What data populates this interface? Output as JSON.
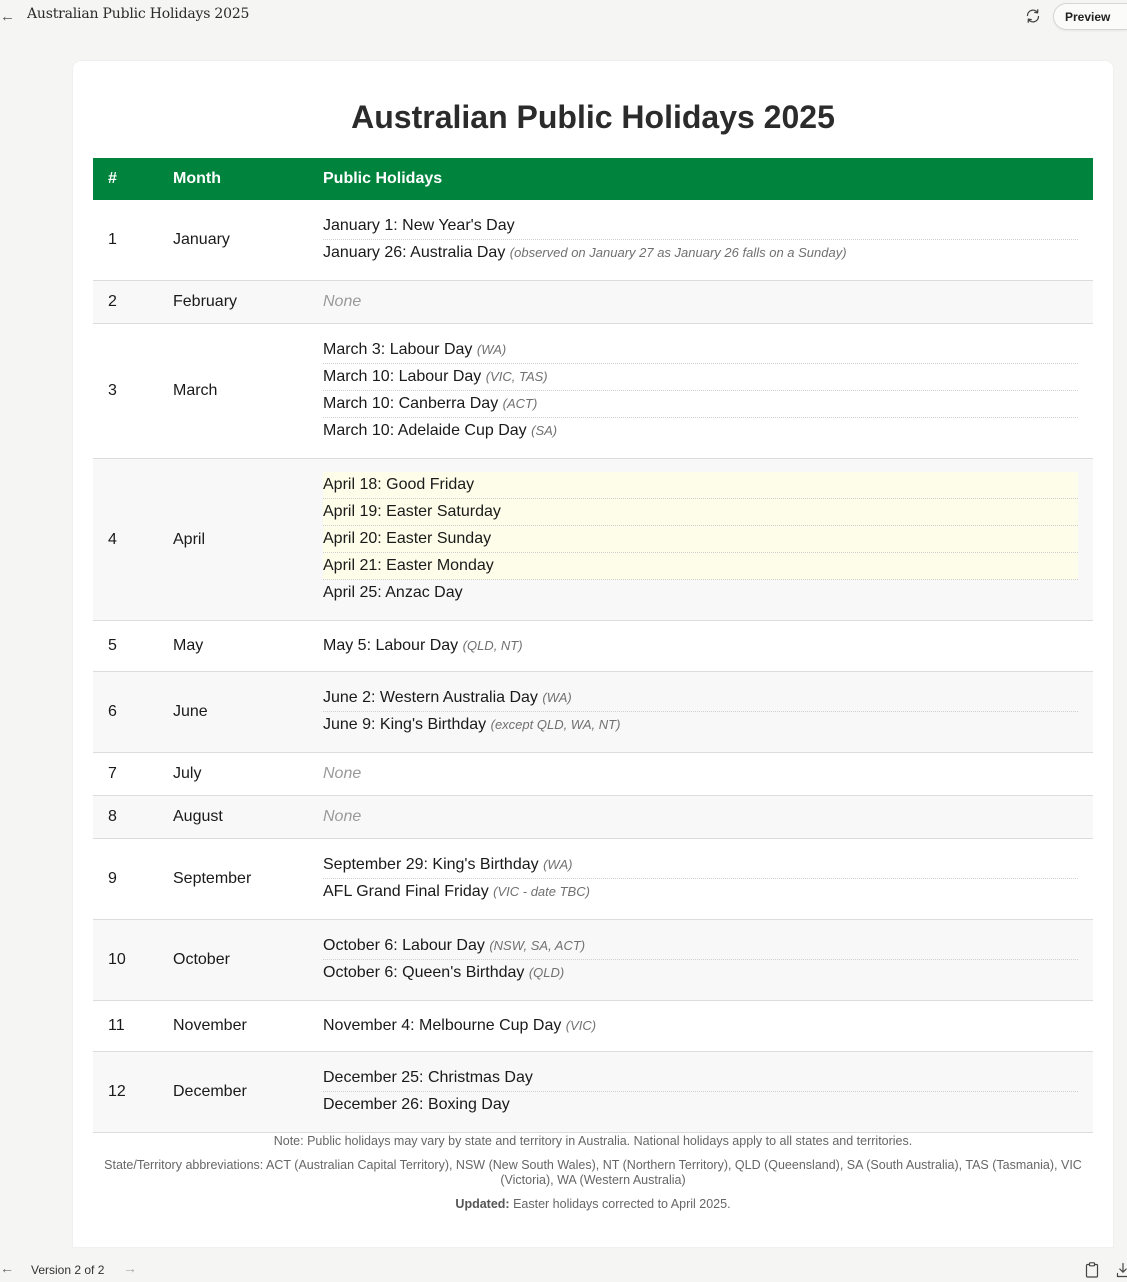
{
  "topbar": {
    "title": "Australian Public Holidays 2025",
    "preview_label": "Preview"
  },
  "page": {
    "title": "Australian Public Holidays 2025"
  },
  "table": {
    "headers": [
      "#",
      "Month",
      "Public Holidays"
    ],
    "rows": [
      {
        "num": "1",
        "month": "January",
        "holidays": [
          {
            "text": "January 1: New Year's Day",
            "note": "",
            "highlight": false
          },
          {
            "text": "January 26: Australia Day",
            "note": "(observed on January 27 as January 26 falls on a Sunday)",
            "highlight": false
          }
        ]
      },
      {
        "num": "2",
        "month": "February",
        "none": "None",
        "holidays": []
      },
      {
        "num": "3",
        "month": "March",
        "holidays": [
          {
            "text": "March 3: Labour Day",
            "note": "(WA)",
            "highlight": false
          },
          {
            "text": "March 10: Labour Day",
            "note": "(VIC, TAS)",
            "highlight": false
          },
          {
            "text": "March 10: Canberra Day",
            "note": "(ACT)",
            "highlight": false
          },
          {
            "text": "March 10: Adelaide Cup Day",
            "note": "(SA)",
            "highlight": false
          }
        ]
      },
      {
        "num": "4",
        "month": "April",
        "holidays": [
          {
            "text": "April 18: Good Friday",
            "note": "",
            "highlight": true
          },
          {
            "text": "April 19: Easter Saturday",
            "note": "",
            "highlight": true
          },
          {
            "text": "April 20: Easter Sunday",
            "note": "",
            "highlight": true
          },
          {
            "text": "April 21: Easter Monday",
            "note": "",
            "highlight": true
          },
          {
            "text": "April 25: Anzac Day",
            "note": "",
            "highlight": false
          }
        ]
      },
      {
        "num": "5",
        "month": "May",
        "holidays": [
          {
            "text": "May 5: Labour Day",
            "note": "(QLD, NT)",
            "highlight": false
          }
        ]
      },
      {
        "num": "6",
        "month": "June",
        "holidays": [
          {
            "text": "June 2: Western Australia Day",
            "note": "(WA)",
            "highlight": false
          },
          {
            "text": "June 9: King's Birthday",
            "note": "(except QLD, WA, NT)",
            "highlight": false
          }
        ]
      },
      {
        "num": "7",
        "month": "July",
        "none": "None",
        "holidays": []
      },
      {
        "num": "8",
        "month": "August",
        "none": "None",
        "holidays": []
      },
      {
        "num": "9",
        "month": "September",
        "holidays": [
          {
            "text": "September 29: King's Birthday",
            "note": "(WA)",
            "highlight": false
          },
          {
            "text": "AFL Grand Final Friday",
            "note": "(VIC - date TBC)",
            "highlight": false
          }
        ]
      },
      {
        "num": "10",
        "month": "October",
        "holidays": [
          {
            "text": "October 6: Labour Day",
            "note": "(NSW, SA, ACT)",
            "highlight": false
          },
          {
            "text": "October 6: Queen's Birthday",
            "note": "(QLD)",
            "highlight": false
          }
        ]
      },
      {
        "num": "11",
        "month": "November",
        "holidays": [
          {
            "text": "November 4: Melbourne Cup Day",
            "note": "(VIC)",
            "highlight": false
          }
        ]
      },
      {
        "num": "12",
        "month": "December",
        "holidays": [
          {
            "text": "December 25: Christmas Day",
            "note": "",
            "highlight": false
          },
          {
            "text": "December 26: Boxing Day",
            "note": "",
            "highlight": false
          }
        ]
      }
    ]
  },
  "footnotes": {
    "note": "Note: Public holidays may vary by state and territory in Australia. National holidays apply to all states and territories.",
    "abbreviations": "State/Territory abbreviations: ACT (Australian Capital Territory), NSW (New South Wales), NT (Northern Territory), QLD (Queensland), SA (South Australia), TAS (Tasmania), VIC (Victoria), WA (Western Australia)",
    "updated_label": "Updated:",
    "updated_text": " Easter holidays corrected to April 2025."
  },
  "bottombar": {
    "version": "Version 2 of 2"
  },
  "colors": {
    "header_green": "#00843d",
    "easter_highlight": "#fefde9",
    "alt_row": "#f8f8f8"
  },
  "icons": {
    "back": "arrow-left-icon",
    "refresh": "refresh-icon",
    "prev": "arrow-left-icon",
    "next": "arrow-right-icon",
    "copy": "clipboard-icon",
    "download": "download-icon"
  }
}
